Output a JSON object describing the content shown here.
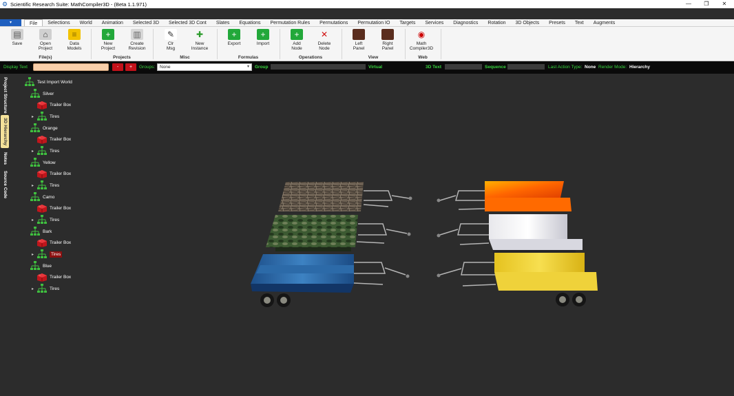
{
  "window": {
    "title": "Scientific Research Suite: MathCompiler3D - (Beta 1.1.971)"
  },
  "menu_tabs": [
    "File",
    "Selections",
    "World",
    "Animation",
    "Selected 3D",
    "Selected 3D Cont",
    "Slates",
    "Equations",
    "Permutation Rules",
    "Permutations",
    "Permutation IO",
    "Targets",
    "Services",
    "Diagnostics",
    "Rotation",
    "3D Objects",
    "Presets",
    "Text",
    "Augments"
  ],
  "active_tab": "File",
  "ribbon": {
    "buttons": [
      {
        "id": "save",
        "l1": "Save",
        "l2": ""
      },
      {
        "id": "open",
        "l1": "Open",
        "l2": "Project"
      },
      {
        "id": "data",
        "l1": "Data",
        "l2": "Models"
      },
      {
        "id": "newproj",
        "l1": "New",
        "l2": "Project"
      },
      {
        "id": "createrev",
        "l1": "Create",
        "l2": "Revision"
      },
      {
        "id": "clrmsg",
        "l1": "Clr",
        "l2": "Msg"
      },
      {
        "id": "newinst",
        "l1": "New",
        "l2": "Instance"
      },
      {
        "id": "export",
        "l1": "Export",
        "l2": ""
      },
      {
        "id": "import",
        "l1": "Import",
        "l2": ""
      },
      {
        "id": "addnode",
        "l1": "Add",
        "l2": "Node"
      },
      {
        "id": "delnode",
        "l1": "Delete",
        "l2": "Node"
      },
      {
        "id": "leftpanel",
        "l1": "Left",
        "l2": "Panel"
      },
      {
        "id": "rightpanel",
        "l1": "Right",
        "l2": "Panel"
      },
      {
        "id": "mathcomp",
        "l1": "Math",
        "l2": "Compiler3D"
      }
    ],
    "groups": [
      "File(s)",
      "Projects",
      "Misc",
      "Formulas",
      "Operations",
      "View",
      "Web"
    ]
  },
  "statusbar": {
    "display_text_label": "Display Text",
    "minus": "-",
    "plus": "+",
    "groups_label": "Groups:",
    "groups_value": "None",
    "group_label": "Group",
    "virtual_label": "Virtual",
    "text3d_label": "3D Text",
    "sequence_label": "Sequence",
    "last_action_label": "Last Action Type:",
    "last_action_value": "None",
    "render_mode_label": "Render Mode:",
    "render_mode_value": "Hierarchy"
  },
  "side_tabs": [
    "Project Structure",
    "3D Hierarchy",
    "Notes",
    "Source Code"
  ],
  "active_side_tab": "3D Hierarchy",
  "tree": {
    "root": "Test Import World",
    "groups": [
      {
        "name": "Silver",
        "box": "Trailer Box",
        "tires": "Tires"
      },
      {
        "name": "Orange",
        "box": "Trailer Box",
        "tires": "Tires"
      },
      {
        "name": "Yellow",
        "box": "Trailer Box",
        "tires": "Tires"
      },
      {
        "name": "Camo",
        "box": "Trailer Box",
        "tires": "Tires"
      },
      {
        "name": "Bark",
        "box": "Trailer Box",
        "tires": "Tires",
        "selected": true
      },
      {
        "name": "Blue",
        "box": "Trailer Box",
        "tires": "Tires"
      }
    ]
  },
  "colors": {
    "accent_blue": "#1f5fbf",
    "status_green": "#39d53f",
    "selection_red": "#8b1010",
    "viewport_bg": "#2c2c2c"
  }
}
